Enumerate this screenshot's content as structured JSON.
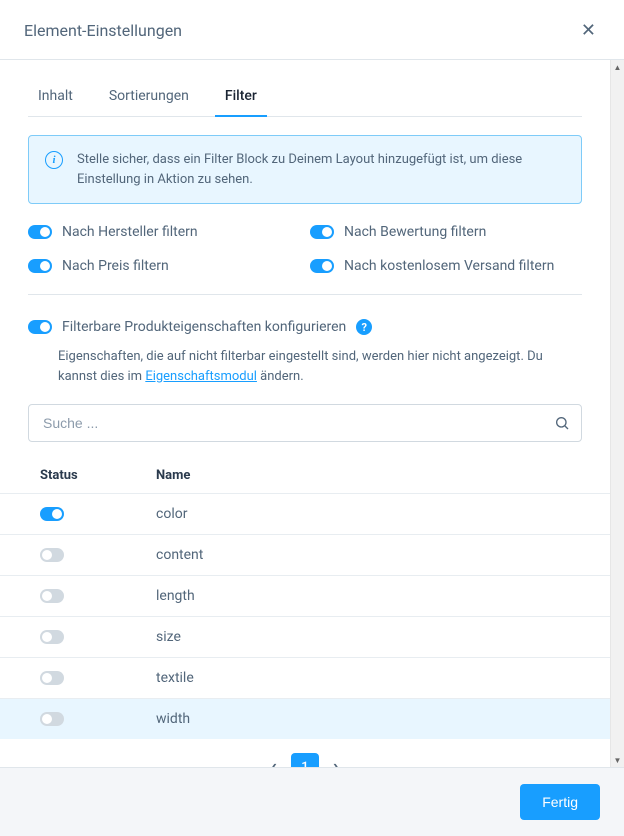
{
  "header": {
    "title": "Element-Einstellungen"
  },
  "tabs": [
    {
      "label": "Inhalt",
      "active": false
    },
    {
      "label": "Sortierungen",
      "active": false
    },
    {
      "label": "Filter",
      "active": true
    }
  ],
  "alert": {
    "text": "Stelle sicher, dass ein Filter Block zu Deinem Layout hinzugefügt ist, um diese Einstellung in Aktion zu sehen."
  },
  "toggles": {
    "manufacturer": {
      "label": "Nach Hersteller filtern",
      "on": true
    },
    "rating": {
      "label": "Nach Bewertung filtern",
      "on": true
    },
    "price": {
      "label": "Nach Preis filtern",
      "on": true
    },
    "shipping": {
      "label": "Nach kostenlosem Versand filtern",
      "on": true
    }
  },
  "config": {
    "label": "Filterbare Produkteigenschaften konfigurieren",
    "on": true,
    "desc_before": "Eigenschaften, die auf nicht filterbar eingestellt sind, werden hier nicht angezeigt. Du kannst dies im ",
    "desc_link": "Eigenschaftsmodul",
    "desc_after": " ändern."
  },
  "search": {
    "placeholder": "Suche ..."
  },
  "table": {
    "headers": {
      "status": "Status",
      "name": "Name"
    },
    "rows": [
      {
        "name": "color",
        "on": true,
        "hl": false
      },
      {
        "name": "content",
        "on": false,
        "hl": false
      },
      {
        "name": "length",
        "on": false,
        "hl": false
      },
      {
        "name": "size",
        "on": false,
        "hl": false
      },
      {
        "name": "textile",
        "on": false,
        "hl": false
      },
      {
        "name": "width",
        "on": false,
        "hl": true
      }
    ]
  },
  "pagination": {
    "current": "1"
  },
  "footer": {
    "done": "Fertig"
  }
}
